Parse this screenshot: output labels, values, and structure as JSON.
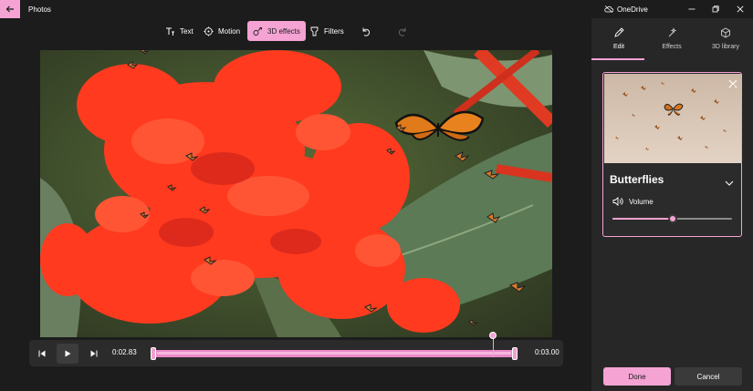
{
  "app": {
    "title": "Photos",
    "onedrive_label": "OneDrive"
  },
  "toolbar": {
    "items": [
      {
        "label": "Text",
        "icon": "text-icon"
      },
      {
        "label": "Motion",
        "icon": "motion-icon"
      },
      {
        "label": "3D effects",
        "icon": "3d-effects-icon",
        "active": true
      },
      {
        "label": "Filters",
        "icon": "filters-icon"
      }
    ],
    "undo_icon": "undo-icon",
    "redo_icon": "redo-icon"
  },
  "playback": {
    "current_time": "0:02.83",
    "end_time": "0:03.00",
    "playhead_fraction": 0.94
  },
  "panel": {
    "tabs": [
      {
        "label": "Edit",
        "icon": "pencil-icon",
        "active": true
      },
      {
        "label": "Effects",
        "icon": "sparkle-icon"
      },
      {
        "label": "3D library",
        "icon": "cube-icon"
      }
    ],
    "effect": {
      "title": "Butterflies",
      "volume_label": "Volume",
      "volume_fraction": 0.5
    },
    "done_label": "Done",
    "cancel_label": "Cancel"
  },
  "colors": {
    "accent": "#f4a3d3",
    "background": "#1c1c1c",
    "panel": "#272727"
  }
}
